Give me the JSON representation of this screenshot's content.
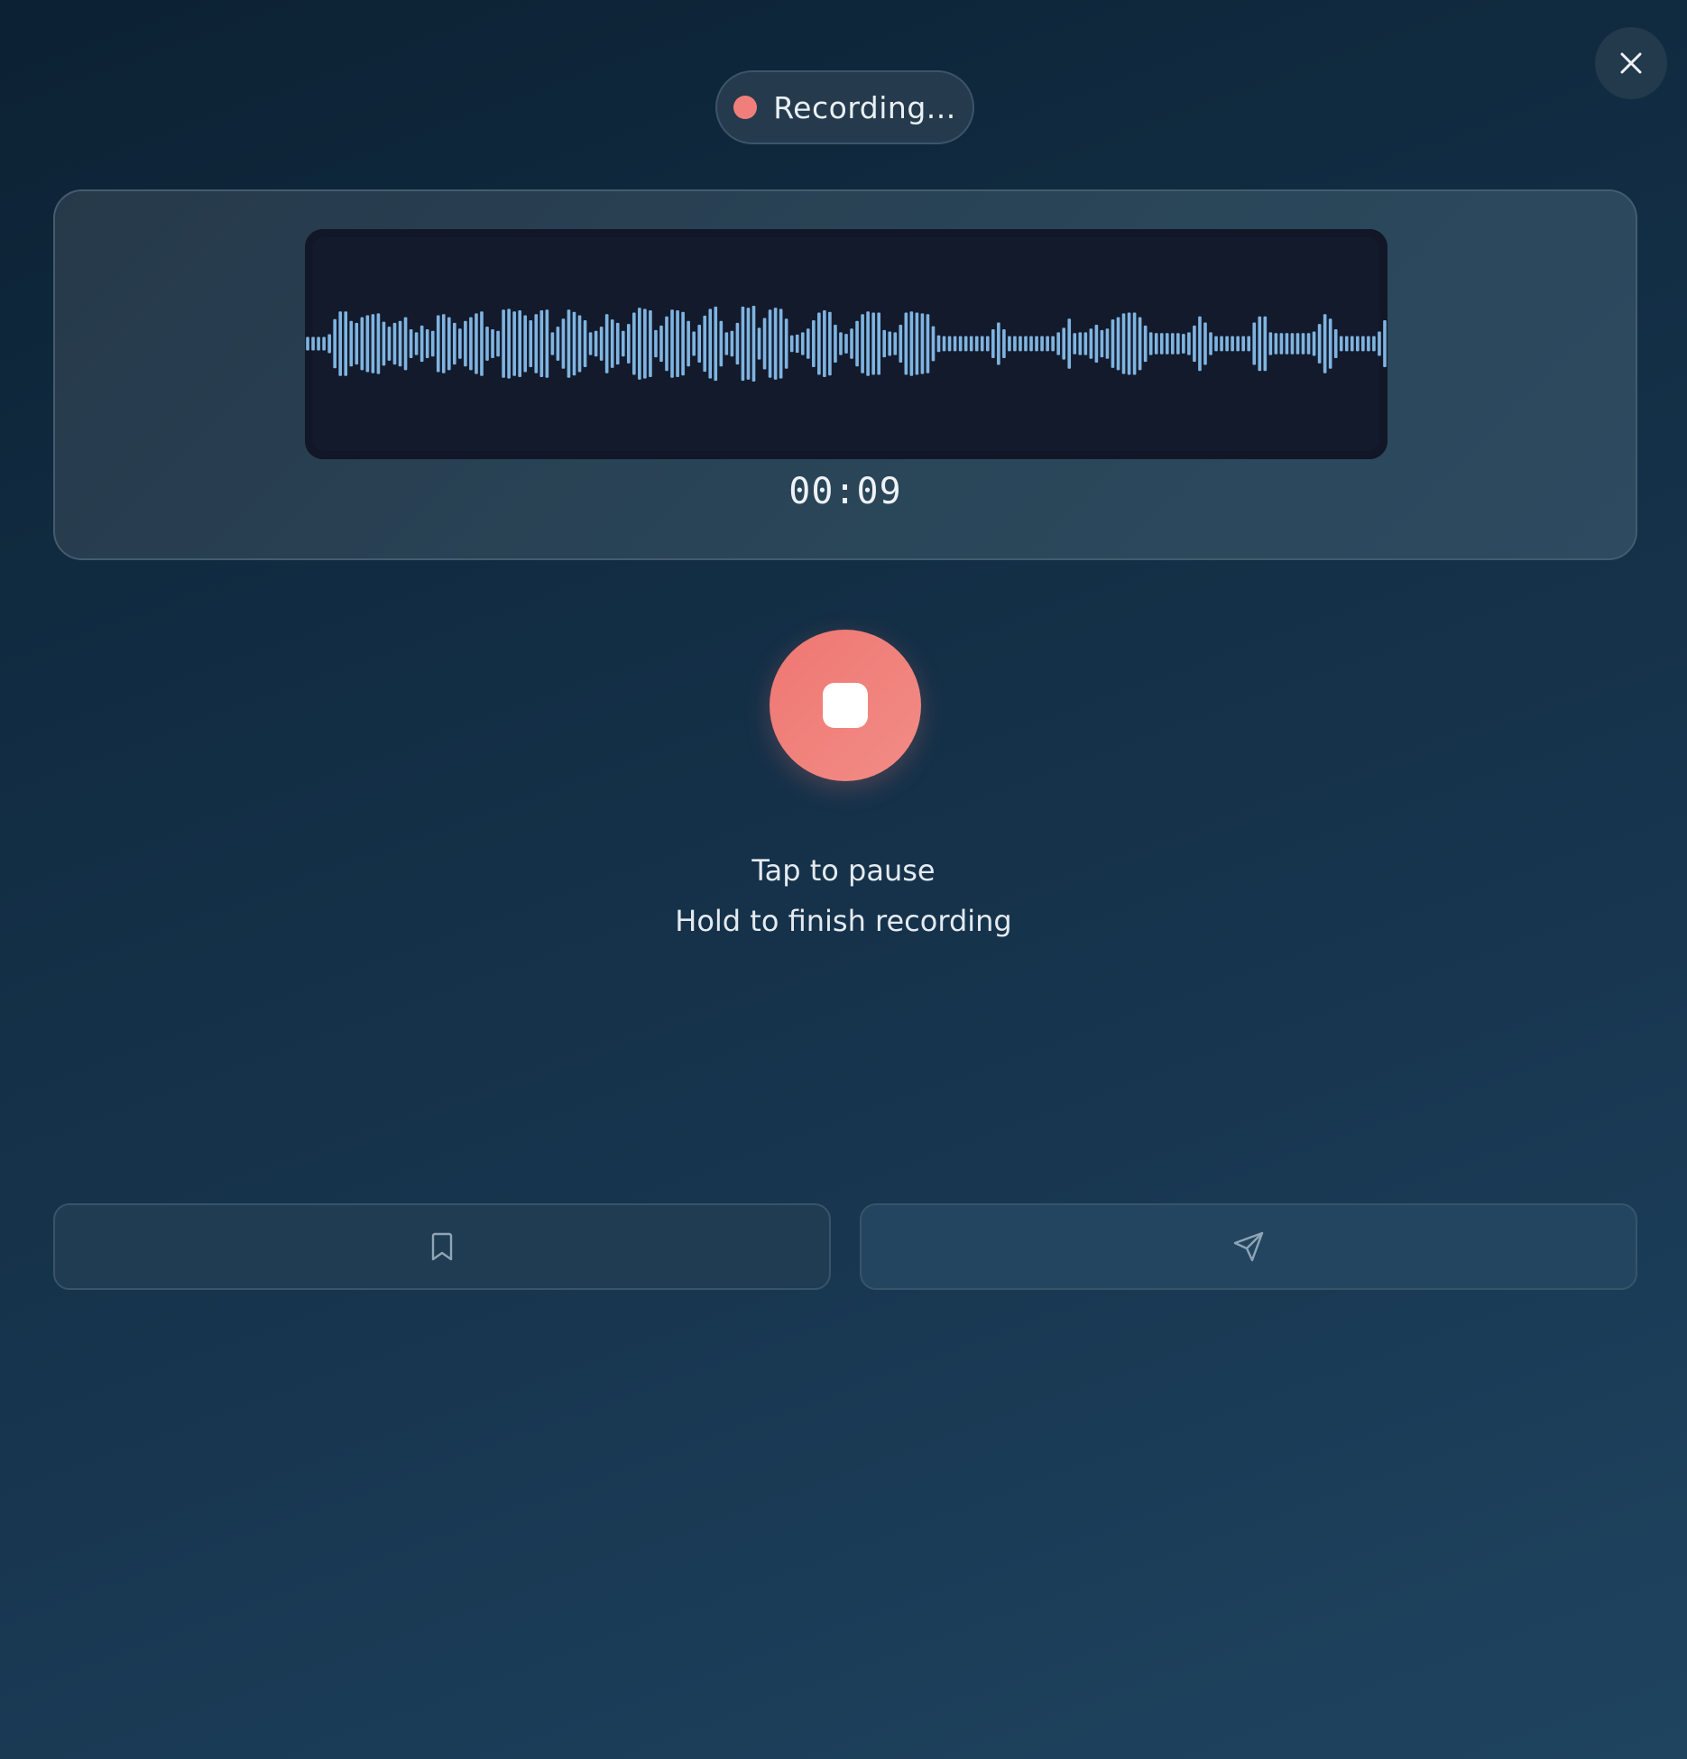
{
  "header": {
    "status_text": "Recording...",
    "status_color": "#f07f7b",
    "close_icon": "close-icon"
  },
  "waveform": {
    "bar_color": "#7fb4e0",
    "levels": [
      0.18,
      0.18,
      0.18,
      0.18,
      0.25,
      0.65,
      0.85,
      0.85,
      0.6,
      0.55,
      0.7,
      0.75,
      0.78,
      0.8,
      0.58,
      0.45,
      0.55,
      0.6,
      0.7,
      0.38,
      0.3,
      0.48,
      0.38,
      0.34,
      0.75,
      0.78,
      0.7,
      0.55,
      0.4,
      0.6,
      0.7,
      0.8,
      0.85,
      0.45,
      0.38,
      0.34,
      0.9,
      0.92,
      0.85,
      0.88,
      0.75,
      0.62,
      0.78,
      0.88,
      0.9,
      0.3,
      0.45,
      0.66,
      0.9,
      0.84,
      0.75,
      0.62,
      0.3,
      0.34,
      0.45,
      0.78,
      0.64,
      0.55,
      0.34,
      0.52,
      0.82,
      0.95,
      0.92,
      0.88,
      0.36,
      0.48,
      0.72,
      0.9,
      0.88,
      0.84,
      0.6,
      0.32,
      0.5,
      0.74,
      0.92,
      0.98,
      0.6,
      0.3,
      0.34,
      0.55,
      0.98,
      0.95,
      1.0,
      0.42,
      0.68,
      0.9,
      0.95,
      0.92,
      0.66,
      0.22,
      0.24,
      0.3,
      0.4,
      0.62,
      0.82,
      0.88,
      0.84,
      0.5,
      0.3,
      0.26,
      0.4,
      0.6,
      0.78,
      0.85,
      0.82,
      0.82,
      0.36,
      0.32,
      0.3,
      0.5,
      0.82,
      0.85,
      0.82,
      0.8,
      0.78,
      0.46,
      0.22,
      0.2,
      0.2,
      0.2,
      0.2,
      0.2,
      0.2,
      0.2,
      0.2,
      0.2,
      0.38,
      0.56,
      0.38,
      0.2,
      0.2,
      0.2,
      0.2,
      0.2,
      0.2,
      0.2,
      0.2,
      0.2,
      0.3,
      0.42,
      0.66,
      0.28,
      0.3,
      0.3,
      0.4,
      0.5,
      0.36,
      0.4,
      0.64,
      0.7,
      0.8,
      0.82,
      0.82,
      0.7,
      0.48,
      0.3,
      0.28,
      0.28,
      0.28,
      0.28,
      0.28,
      0.26,
      0.3,
      0.48,
      0.72,
      0.56,
      0.3,
      0.2,
      0.2,
      0.2,
      0.2,
      0.2,
      0.2,
      0.2,
      0.56,
      0.72,
      0.72,
      0.3,
      0.28,
      0.28,
      0.28,
      0.28,
      0.28,
      0.28,
      0.28,
      0.32,
      0.52,
      0.78,
      0.66,
      0.38,
      0.2,
      0.2,
      0.2,
      0.2,
      0.2,
      0.2,
      0.2,
      0.32,
      0.62
    ]
  },
  "timer": "00:09",
  "controls": {
    "record_button_icon": "stop-icon",
    "record_color": "#ef7772",
    "hint_tap": "Tap to pause",
    "hint_hold": "Hold to finish recording"
  },
  "actions": {
    "save_icon": "bookmark-icon",
    "send_icon": "send-icon"
  }
}
